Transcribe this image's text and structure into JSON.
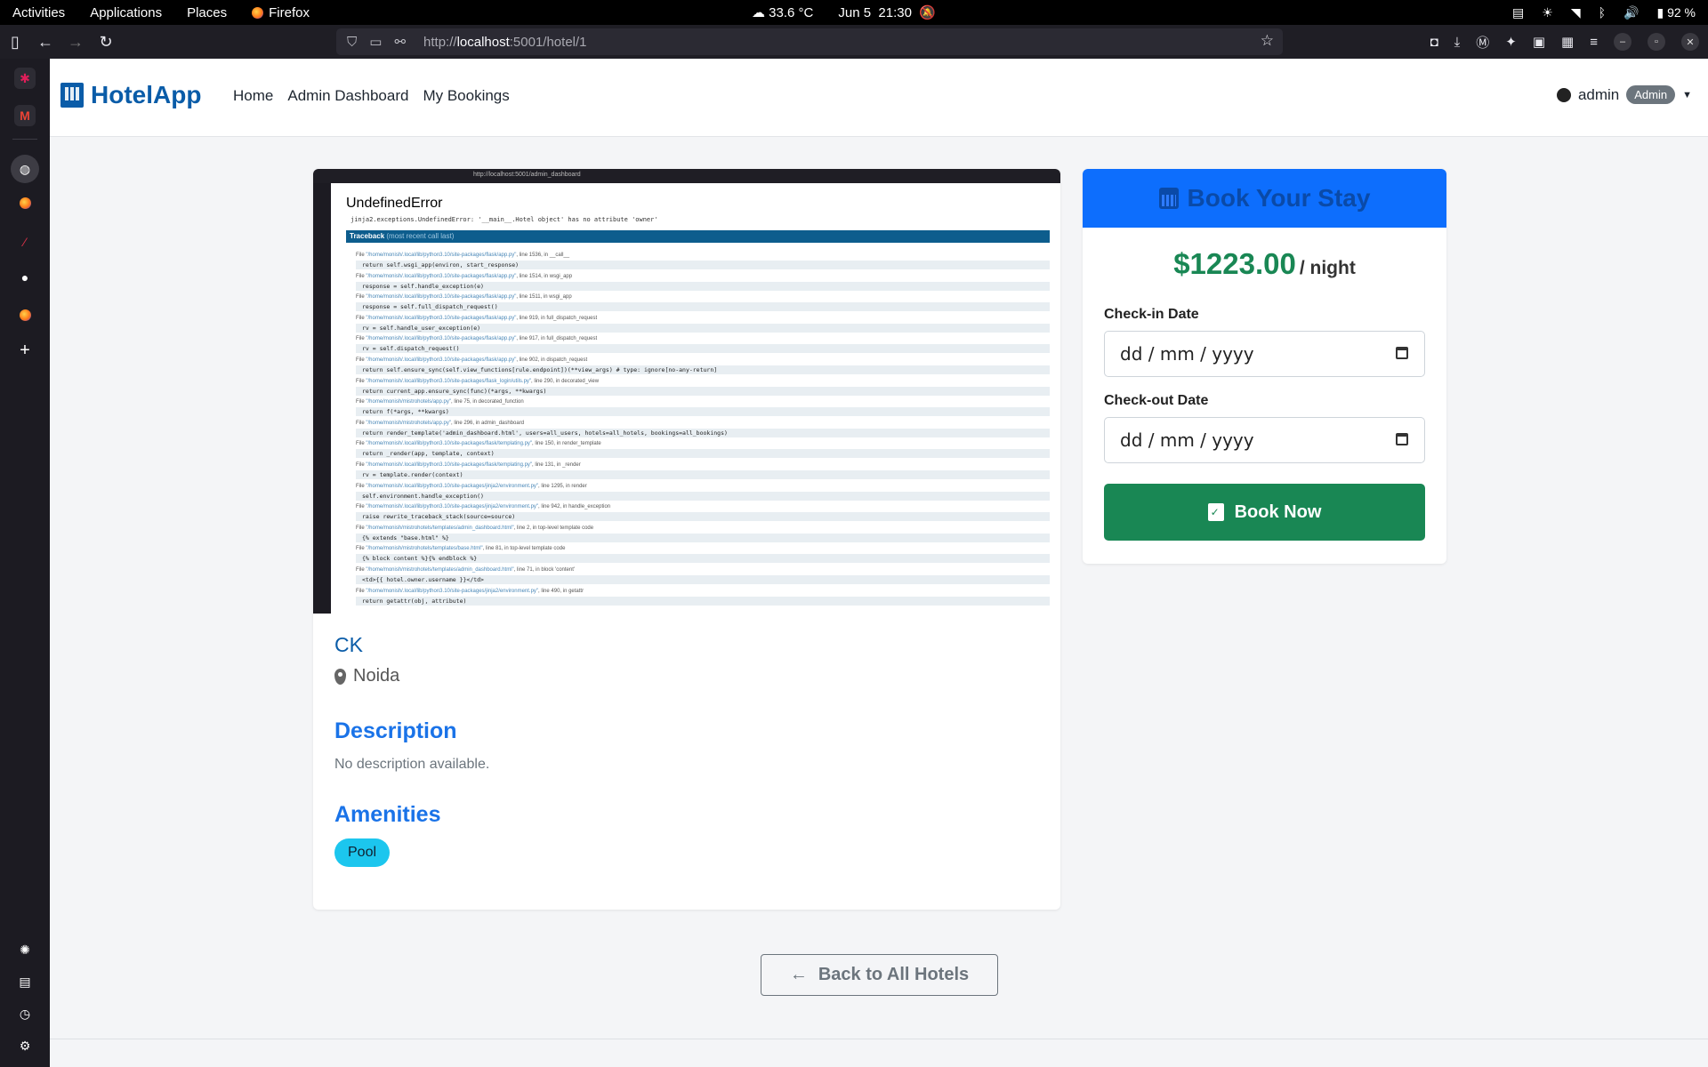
{
  "system_bar": {
    "activities": "Activities",
    "applications": "Applications",
    "places": "Places",
    "firefox": "Firefox",
    "temperature": "33.6 °C",
    "date": "Jun 5",
    "time": "21:30",
    "battery": "92 %"
  },
  "browser": {
    "url_prefix": "http://",
    "url_host": "localhost",
    "url_rest": ":5001/hotel/1"
  },
  "navbar": {
    "brand": "HotelApp",
    "links": [
      "Home",
      "Admin Dashboard",
      "My Bookings"
    ],
    "username": "admin",
    "role_badge": "Admin"
  },
  "hotel_image": {
    "url": "http://localhost:5001/admin_dashboard",
    "error_title": "UndefinedError",
    "error_message": "jinja2.exceptions.UndefinedError: '__main__.Hotel object' has no attribute 'owner'",
    "traceback_label": "Traceback",
    "traceback_hint": "(most recent call last)",
    "frames": [
      {
        "file": "\"/home/monish/.local/lib/python3.10/site-packages/flask/app.py\"",
        "line": "line 1536, in __call__",
        "code": "return self.wsgi_app(environ, start_response)"
      },
      {
        "file": "\"/home/monish/.local/lib/python3.10/site-packages/flask/app.py\"",
        "line": "line 1514, in wsgi_app",
        "code": "response = self.handle_exception(e)"
      },
      {
        "file": "\"/home/monish/.local/lib/python3.10/site-packages/flask/app.py\"",
        "line": "line 1511, in wsgi_app",
        "code": "response = self.full_dispatch_request()"
      },
      {
        "file": "\"/home/monish/.local/lib/python3.10/site-packages/flask/app.py\"",
        "line": "line 919, in full_dispatch_request",
        "code": "rv = self.handle_user_exception(e)"
      },
      {
        "file": "\"/home/monish/.local/lib/python3.10/site-packages/flask/app.py\"",
        "line": "line 917, in full_dispatch_request",
        "code": "rv = self.dispatch_request()"
      },
      {
        "file": "\"/home/monish/.local/lib/python3.10/site-packages/flask/app.py\"",
        "line": "line 902, in dispatch_request",
        "code": "return self.ensure_sync(self.view_functions[rule.endpoint])(**view_args)  # type: ignore[no-any-return]"
      },
      {
        "file": "\"/home/monish/.local/lib/python3.10/site-packages/flask_login/utils.py\"",
        "line": "line 290, in decorated_view",
        "code": "return current_app.ensure_sync(func)(*args, **kwargs)"
      },
      {
        "file": "\"/home/monish/mistrohotels/app.py\"",
        "line": "line 75, in decorated_function",
        "code": "return f(*args, **kwargs)"
      },
      {
        "file": "\"/home/monish/mistrohotels/app.py\"",
        "line": "line 296, in admin_dashboard",
        "code": "return render_template('admin_dashboard.html', users=all_users, hotels=all_hotels, bookings=all_bookings)"
      },
      {
        "file": "\"/home/monish/.local/lib/python3.10/site-packages/flask/templating.py\"",
        "line": "line 150, in render_template",
        "code": "return _render(app, template, context)"
      },
      {
        "file": "\"/home/monish/.local/lib/python3.10/site-packages/flask/templating.py\"",
        "line": "line 131, in _render",
        "code": "rv = template.render(context)"
      },
      {
        "file": "\"/home/monish/.local/lib/python3.10/site-packages/jinja2/environment.py\"",
        "line": "line 1295, in render",
        "code": "self.environment.handle_exception()"
      },
      {
        "file": "\"/home/monish/.local/lib/python3.10/site-packages/jinja2/environment.py\"",
        "line": "line 942, in handle_exception",
        "code": "raise rewrite_traceback_stack(source=source)"
      },
      {
        "file": "\"/home/monish/mistrohotels/templates/admin_dashboard.html\"",
        "line": "line 2, in top-level template code",
        "code": "{% extends \"base.html\" %}"
      },
      {
        "file": "\"/home/monish/mistrohotels/templates/base.html\"",
        "line": "line 81, in top-level template code",
        "code": "{% block content %}{% endblock %}"
      },
      {
        "file": "\"/home/monish/mistrohotels/templates/admin_dashboard.html\"",
        "line": "line 71, in block 'content'",
        "code": "<td>{{ hotel.owner.username }}</td>"
      },
      {
        "file": "\"/home/monish/.local/lib/python3.10/site-packages/jinja2/environment.py\"",
        "line": "line 490, in getattr",
        "code": "return getattr(obj, attribute)"
      }
    ]
  },
  "hotel": {
    "name": "CK",
    "location": "Noida",
    "description_heading": "Description",
    "description": "No description available.",
    "amenities_heading": "Amenities",
    "amenities": [
      "Pool"
    ]
  },
  "booking": {
    "heading": "Book Your Stay",
    "price": "$1223.00",
    "per_night": "/ night",
    "checkin_label": "Check-in Date",
    "checkin_placeholder": "dd / mm / yyyy",
    "checkout_label": "Check-out Date",
    "checkout_placeholder": "dd / mm / yyyy",
    "book_button": "Book Now"
  },
  "back_button": "Back to All Hotels",
  "colors": {
    "brand": "#0a5ca8",
    "primary": "#0d6efd",
    "success": "#198754",
    "info_pill": "#1cc6ee"
  }
}
